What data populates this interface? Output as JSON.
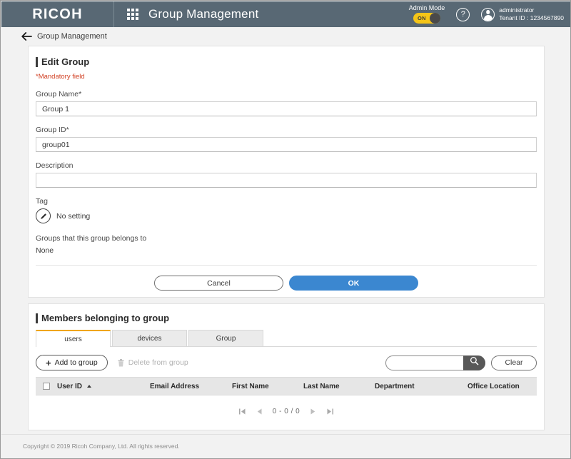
{
  "header": {
    "logo": "RICOH",
    "grid_icon": "apps-grid-icon",
    "app_title": "Group Management",
    "admin_mode_label": "Admin Mode",
    "admin_mode_state": "ON",
    "help_icon": "?",
    "user_name": "administrator",
    "tenant_id": "Tenant ID : 1234567890",
    "bar_color": "#586874",
    "toggle_color": "#f5c518"
  },
  "breadcrumb": {
    "label": "Group Management",
    "back_icon": "back-arrow-icon"
  },
  "edit_group": {
    "title": "Edit Group",
    "mandatory_note": "*Mandatory field",
    "mandatory_color": "#d14124",
    "fields": [
      {
        "label": "Group Name*",
        "value": "Group 1",
        "placeholder": ""
      },
      {
        "label": "Group ID*",
        "value": "group01",
        "placeholder": ""
      },
      {
        "label": "Description",
        "value": "",
        "placeholder": ""
      }
    ],
    "tag_label": "Tag",
    "tag_value": "No setting",
    "tag_icon": "pencil-edit-icon",
    "belongs_label": "Groups that this group belongs to",
    "belongs_value": "None",
    "cancel_label": "Cancel",
    "ok_label": "OK",
    "ok_color": "#3b87d0"
  },
  "members": {
    "title": "Members belonging to group",
    "tabs": [
      {
        "label": "users",
        "active": true
      },
      {
        "label": "devices",
        "active": false
      },
      {
        "label": "Group",
        "active": false
      }
    ],
    "active_tab_accent": "#f0a500",
    "toolbar": {
      "add_label": "Add to group",
      "add_icon": "plus-icon",
      "delete_label": "Delete from group",
      "delete_icon": "trash-icon",
      "delete_disabled": true,
      "search_value": "",
      "search_placeholder": "",
      "search_icon": "search-icon",
      "clear_label": "Clear"
    },
    "table": {
      "columns": [
        "User ID",
        "Email Address",
        "First Name",
        "Last Name",
        "Department",
        "Office Location"
      ],
      "sort_column": "User ID",
      "sort_direction": "ascending",
      "select_all_checkbox": false,
      "rows": []
    },
    "pagination": {
      "first_icon": "page-first-icon",
      "prev_icon": "page-prev-icon",
      "count": "0 - 0 / 0",
      "next_icon": "page-next-icon",
      "last_icon": "page-last-icon"
    }
  },
  "footer": {
    "copyright": "Copyright © 2019 Ricoh Company, Ltd. All rights reserved."
  }
}
